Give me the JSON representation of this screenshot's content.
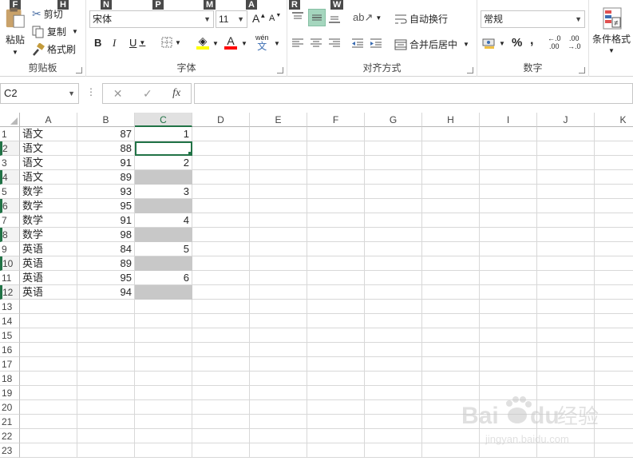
{
  "keytips": [
    "F",
    "H",
    "N",
    "P",
    "M",
    "A",
    "R",
    "W"
  ],
  "clipboard": {
    "paste": "粘贴",
    "cut": "剪切",
    "copy": "复制",
    "format_painter": "格式刷",
    "label": "剪贴板"
  },
  "font": {
    "name": "宋体",
    "size": "11",
    "bold": "B",
    "italic": "I",
    "underline": "U",
    "label": "字体",
    "grow": "A",
    "shrink": "A",
    "wen": "wén",
    "wen2": "文"
  },
  "alignment": {
    "wrap": "自动换行",
    "merge": "合并后居中",
    "label": "对齐方式"
  },
  "number": {
    "format": "常规",
    "percent": "%",
    "comma": ",",
    "inc_dec": "←.0",
    "inc_dec2": ".00",
    "dec_dec": ".00",
    "dec_dec2": "→.0",
    "label": "数字"
  },
  "styles": {
    "conditional": "条件格式"
  },
  "name_box": "C2",
  "fx": "fx",
  "columns": [
    "A",
    "B",
    "C",
    "D",
    "E",
    "F",
    "G",
    "H",
    "I",
    "J",
    "K"
  ],
  "rows": [
    "1",
    "2",
    "3",
    "4",
    "5",
    "6",
    "7",
    "8",
    "9",
    "10",
    "11",
    "12",
    "13",
    "14",
    "15",
    "16",
    "17",
    "18",
    "19",
    "20",
    "21",
    "22",
    "23"
  ],
  "cells": [
    {
      "a": "语文",
      "b": "87",
      "c": "1"
    },
    {
      "a": "语文",
      "b": "88",
      "c": ""
    },
    {
      "a": "语文",
      "b": "91",
      "c": "2"
    },
    {
      "a": "语文",
      "b": "89",
      "c": ""
    },
    {
      "a": "数学",
      "b": "93",
      "c": "3"
    },
    {
      "a": "数学",
      "b": "95",
      "c": ""
    },
    {
      "a": "数学",
      "b": "91",
      "c": "4"
    },
    {
      "a": "数学",
      "b": "98",
      "c": ""
    },
    {
      "a": "英语",
      "b": "84",
      "c": "5"
    },
    {
      "a": "英语",
      "b": "89",
      "c": ""
    },
    {
      "a": "英语",
      "b": "95",
      "c": "6"
    },
    {
      "a": "英语",
      "b": "94",
      "c": ""
    }
  ],
  "selected_column": "C",
  "selected_rows": [
    "2",
    "4",
    "6",
    "8",
    "10",
    "12"
  ],
  "watermark": {
    "brand": "Bai",
    "brand2": "du",
    "cn": "经验",
    "url": "jingyan.baidu.com"
  },
  "colors": {
    "accent": "#217346",
    "highlight_fill": "#ffff00",
    "font_color": "#ff0000",
    "gray_fill": "#c8c8c8"
  }
}
